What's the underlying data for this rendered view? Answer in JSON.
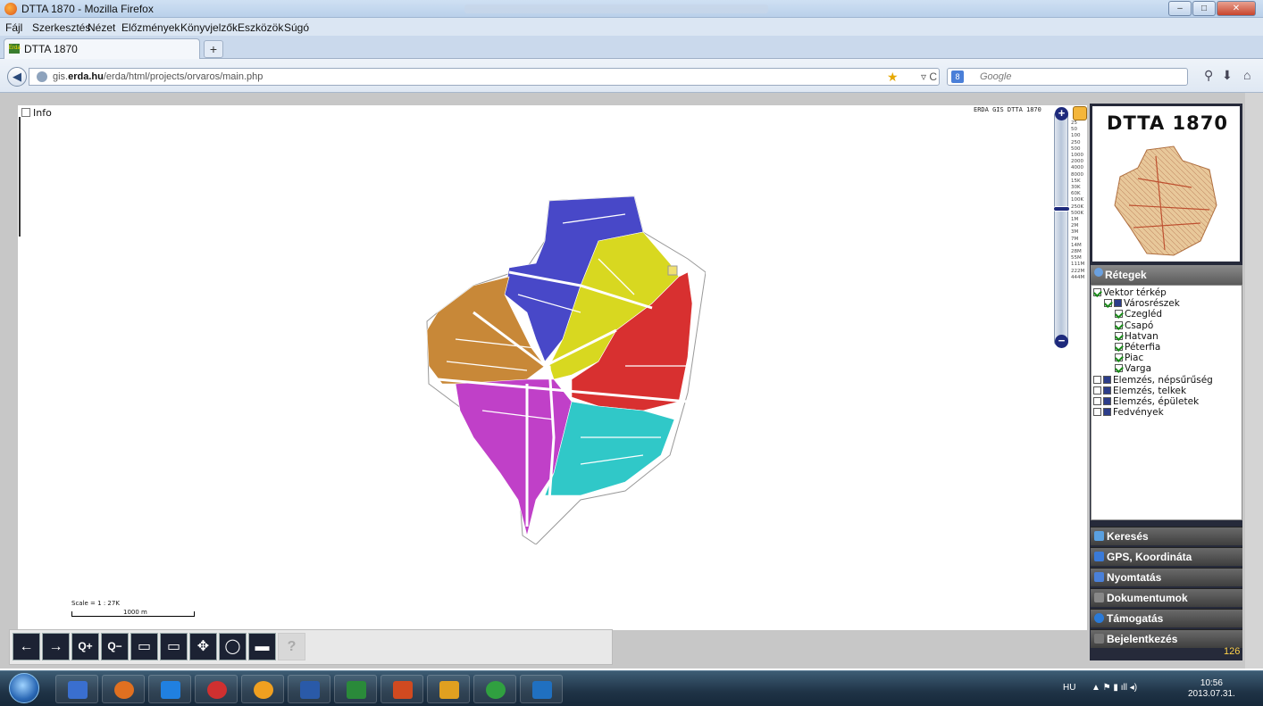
{
  "window": {
    "title": "DTTA 1870 - Mozilla Firefox"
  },
  "menu": [
    "Fájl",
    "Szerkesztés",
    "Nézet",
    "Előzmények",
    "Könyvjelzők",
    "Eszközök",
    "Súgó"
  ],
  "tab": {
    "label": "DTTA 1870",
    "favicon_text": "Erda"
  },
  "url": {
    "prefix": "gis.",
    "domain": "erda.hu",
    "path": "/erda/html/projects/orvaros/main.php"
  },
  "search": {
    "placeholder": "Google"
  },
  "map": {
    "info_label": "Info",
    "brand": "ERDA GIS DTTA 1870",
    "scale_text": "Scale = 1 : 27K",
    "scale_bar_label": "1000 m",
    "zoom_levels": [
      "25",
      "50",
      "100",
      "250",
      "500",
      "1000",
      "2000",
      "4000",
      "8000",
      "15K",
      "30K",
      "60K",
      "100K",
      "250K",
      "500K",
      "1M",
      "2M",
      "3M",
      "7M",
      "14M",
      "28M",
      "55M",
      "111M",
      "222M",
      "444M"
    ],
    "zoom_selected": "30K",
    "colors": {
      "purple_district": "#c040c8",
      "blue_district": "#4848c8",
      "yellow_district": "#d8d820",
      "red_district": "#d83030",
      "cyan_district": "#30c8c8",
      "orange_district": "#c88838"
    }
  },
  "panel": {
    "logo_title": "DTTA 1870",
    "layers_header": "Rétegek",
    "layers": [
      {
        "label": "Vektor térkép",
        "checked": true,
        "indent": 0
      },
      {
        "label": "Városrészek",
        "checked": true,
        "indent": 1,
        "group": true
      },
      {
        "label": "Czegléd",
        "checked": true,
        "indent": 2
      },
      {
        "label": "Csapó",
        "checked": true,
        "indent": 2
      },
      {
        "label": "Hatvan",
        "checked": true,
        "indent": 2
      },
      {
        "label": "Péterfia",
        "checked": true,
        "indent": 2
      },
      {
        "label": "Piac",
        "checked": true,
        "indent": 2
      },
      {
        "label": "Varga",
        "checked": true,
        "indent": 2
      },
      {
        "label": "Elemzés, népsűrűség",
        "checked": false,
        "indent": 0,
        "group": true
      },
      {
        "label": "Elemzés, telkek",
        "checked": false,
        "indent": 0,
        "group": true
      },
      {
        "label": "Elemzés, épületek",
        "checked": false,
        "indent": 0,
        "group": true
      },
      {
        "label": "Fedvények",
        "checked": false,
        "indent": 0,
        "group": true
      }
    ],
    "accordion": [
      "Keresés",
      "GPS, Koordináta",
      "Nyomtatás",
      "Dokumentumok",
      "Támogatás",
      "Bejelentkezés"
    ],
    "counter": "126"
  },
  "toolbar": [
    "←",
    "→",
    "Q+",
    "Q−",
    "▭",
    "▭",
    "✥",
    "◯",
    "▬",
    "?"
  ],
  "taskbar": {
    "lang": "HU",
    "time": "10:56",
    "date": "2013.07.31."
  }
}
